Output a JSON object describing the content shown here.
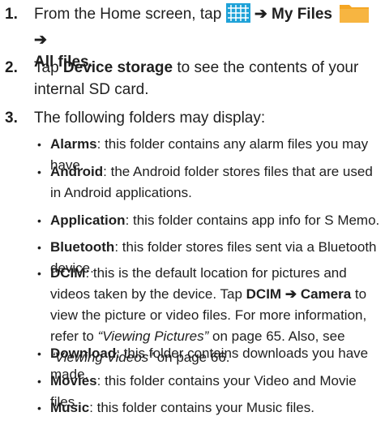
{
  "steps": [
    {
      "number": "1.",
      "text_a": "From the Home screen, tap",
      "arrow": "➔",
      "my_files": "My Files",
      "all_files": "All files",
      "end": ".",
      "apps_icon": "grid-apps-icon",
      "folder_icon": "folder-icon",
      "apps_icon_color": "#1fa2d8",
      "folder_icon_color": "#f5a623"
    },
    {
      "number": "2.",
      "text_a": "Tap",
      "bold": "Device storage",
      "text_b": "to see the contents of your internal SD card."
    },
    {
      "number": "3.",
      "text": "The following folders may display:"
    }
  ],
  "folders": [
    {
      "name": "Alarms",
      "desc": ": this folder contains any alarm files you may have."
    },
    {
      "name": "Android",
      "desc": ": the Android folder stores files that are used in Android applications."
    },
    {
      "name": "Application",
      "desc": ": this folder contains app info for S Memo."
    },
    {
      "name": "Bluetooth",
      "desc": ": this folder stores files sent via a Bluetooth device."
    },
    {
      "name": "DCIM",
      "desc_a": ": this is the default location for pictures and videos taken by the device. Tap",
      "bold_a": "DCIM",
      "arrow": "➔",
      "bold_b": "Camera",
      "desc_b": "to view the picture or video files. For more information, refer to",
      "ref1": "“Viewing Pictures”",
      "desc_c": "on page 65. Also, see",
      "ref2": "“Viewing Videos”",
      "desc_d": "on page 66."
    },
    {
      "name": "Download",
      "desc": ": this folder contains downloads you have made."
    },
    {
      "name": "Movies",
      "desc": ": this folder contains your Video and Movie files."
    },
    {
      "name": "Music",
      "desc": ": this folder contains your Music files."
    }
  ]
}
